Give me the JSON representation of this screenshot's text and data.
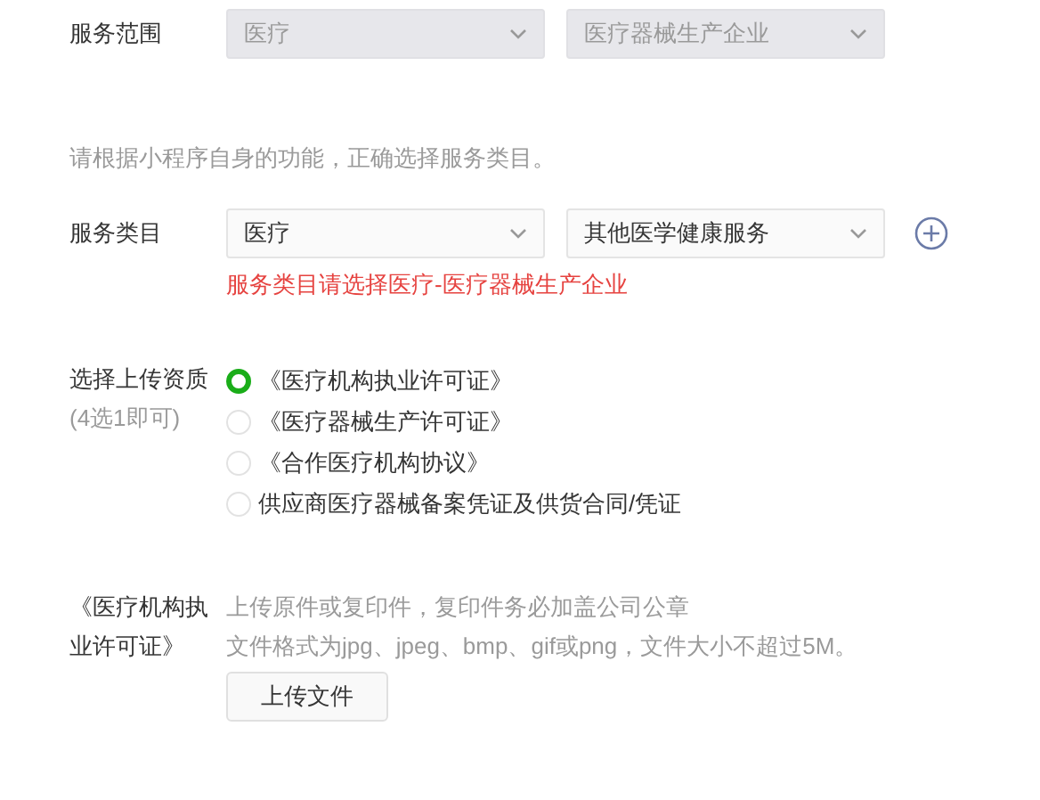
{
  "service_scope": {
    "label": "服务范围",
    "selects": [
      {
        "value": "医疗",
        "disabled": true
      },
      {
        "value": "医疗器械生产企业",
        "disabled": true
      }
    ]
  },
  "hint": "请根据小程序自身的功能，正确选择服务类目。",
  "service_category": {
    "label": "服务类目",
    "selects": [
      {
        "value": "医疗",
        "disabled": false
      },
      {
        "value": "其他医学健康服务",
        "disabled": false
      }
    ],
    "error": "服务类目请选择医疗-医疗器械生产企业"
  },
  "qualification": {
    "label": "选择上传资质",
    "sublabel": "(4选1即可)",
    "options": [
      {
        "label": "《医疗机构执业许可证》",
        "selected": true
      },
      {
        "label": "《医疗器械生产许可证》",
        "selected": false
      },
      {
        "label": "《合作医疗机构协议》",
        "selected": false
      },
      {
        "label": "供应商医疗器械备案凭证及供货合同/凭证",
        "selected": false
      }
    ]
  },
  "upload": {
    "label": "《医疗机构执业许可证》",
    "notes": [
      "上传原件或复印件，复印件务必加盖公司公章",
      "文件格式为jpg、jpeg、bmp、gif或png，文件大小不超过5M。"
    ],
    "button": "上传文件"
  }
}
